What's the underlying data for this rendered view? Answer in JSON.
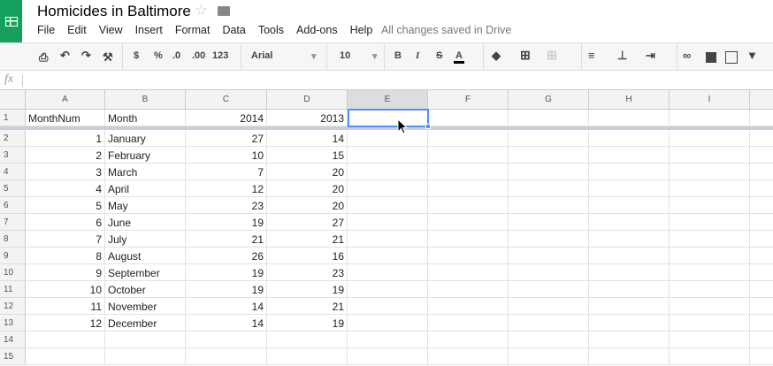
{
  "app": {
    "title": "Homicides in Baltimore",
    "save_status": "All changes saved in Drive",
    "menu": [
      "File",
      "Edit",
      "View",
      "Insert",
      "Format",
      "Data",
      "Tools",
      "Add-ons",
      "Help"
    ]
  },
  "toolbar": {
    "currency": "$",
    "percent": "%",
    "dec_less": ".0",
    "dec_more": ".00",
    "more_formats": "123",
    "font": "Arial",
    "font_size": "10",
    "bold": "B",
    "italic": "I",
    "strike": "S",
    "text_color": "A"
  },
  "formula_bar": {
    "label": "fx",
    "value": ""
  },
  "columns": [
    "A",
    "B",
    "C",
    "D",
    "E",
    "F",
    "G",
    "H",
    "I"
  ],
  "selected_cell": "E1",
  "rows": [
    [
      "MonthNum",
      "Month",
      "2014",
      "2013"
    ],
    [
      "1",
      "January",
      "27",
      "14"
    ],
    [
      "2",
      "February",
      "10",
      "15"
    ],
    [
      "3",
      "March",
      "7",
      "20"
    ],
    [
      "4",
      "April",
      "12",
      "20"
    ],
    [
      "5",
      "May",
      "23",
      "20"
    ],
    [
      "6",
      "June",
      "19",
      "27"
    ],
    [
      "7",
      "July",
      "21",
      "21"
    ],
    [
      "8",
      "August",
      "26",
      "16"
    ],
    [
      "9",
      "September",
      "19",
      "23"
    ],
    [
      "10",
      "October",
      "19",
      "19"
    ],
    [
      "11",
      "November",
      "14",
      "21"
    ],
    [
      "12",
      "December",
      "14",
      "19"
    ],
    [],
    []
  ]
}
